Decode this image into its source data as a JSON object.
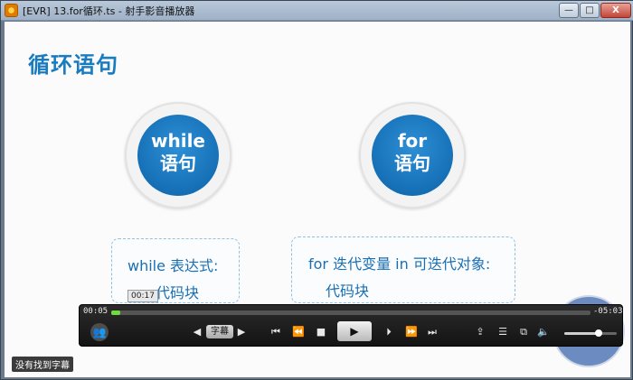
{
  "window": {
    "title": "[EVR] 13.for循环.ts - 射手影音播放器",
    "min_label": "—",
    "max_label": "□",
    "close_label": "X"
  },
  "slide": {
    "title": "循环语句",
    "circles": [
      {
        "line1": "while",
        "line2": "语句"
      },
      {
        "line1": "for",
        "line2": "语句"
      }
    ],
    "boxes": [
      {
        "line1": "while 表达式:",
        "line2": "代码块"
      },
      {
        "line1": "for 迭代变量 in 可迭代对象:",
        "line2": "代码块"
      }
    ],
    "tooltip_time": "00:17"
  },
  "player": {
    "elapsed": "00:05",
    "remaining": "-05:03",
    "progress_fraction": 0.018,
    "subtitle_label": "字幕",
    "no_subtitle_text": "没有找到字幕",
    "volume_fraction": 0.65,
    "icons": {
      "user": "👥",
      "sub_prev": "◀",
      "sub_next": "▶",
      "first": "⏮",
      "rewind": "⏪",
      "stop": "■",
      "play": "▶",
      "step": "⏵",
      "forward": "⏩",
      "last": "⏭",
      "open": "⇪",
      "playlist": "☰",
      "screen": "⧉",
      "volume": "🔈"
    }
  }
}
